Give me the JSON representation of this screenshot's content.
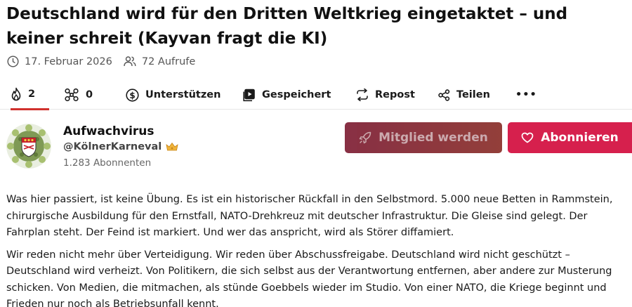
{
  "article": {
    "title": "Deutschland wird für den Dritten Weltkrieg eingetaktet – und keiner schreit (Kayvan fragt die KI)",
    "date": "17. Februar 2026",
    "views": "72 Aufrufe"
  },
  "actions": {
    "likes": "2",
    "shares_count": "0",
    "support": "Unterstützen",
    "saved": "Gespeichert",
    "repost": "Repost",
    "share": "Teilen",
    "more": "•••"
  },
  "author": {
    "name": "Aufwachvirus",
    "handle": "@KölnerKarneval",
    "subscribers": "1.283 Abonnenten"
  },
  "buttons": {
    "member": "Mitglied werden",
    "subscribe": "Abonnieren"
  },
  "body": {
    "p1": "Was hier passiert, ist keine Übung. Es ist ein historischer Rückfall in den Selbstmord. 5.000 neue Betten in Rammstein, chirurgische Ausbildung für den Ernstfall, NATO-Drehkreuz mit deutscher Infrastruktur. Die Gleise sind gelegt. Der Fahrplan steht. Der Feind ist markiert. Und wer das anspricht, wird als Störer diffamiert.",
    "p2": "Wir reden nicht mehr über Verteidigung. Wir reden über Abschussfreigabe. Deutschland wird nicht geschützt – Deutschland wird verheizt. Von Politikern, die sich selbst aus der Verantwortung entfernen, aber andere zur Musterung schicken. Von Medien, die mitmachen, als stünde Goebbels wieder im Studio. Von einer NATO, die Kriege beginnt und Frieden nur noch als Betriebsunfall kennt."
  },
  "colors": {
    "accent": "#d6204d",
    "member_button": "#7e1e34",
    "active_tab_underline": "#d0312d"
  }
}
